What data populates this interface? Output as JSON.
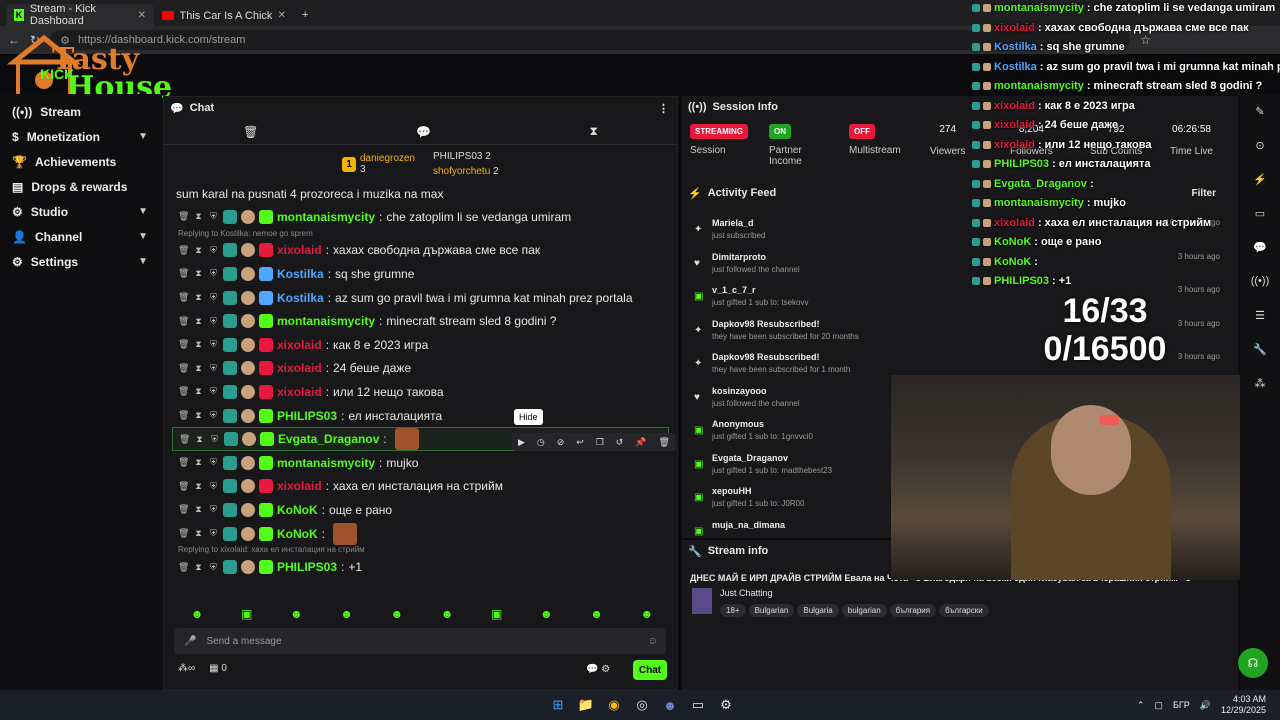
{
  "browser": {
    "tabs": [
      {
        "title": "Stream - Kick Dashboard"
      },
      {
        "title": "This Car Is A Chick Magnet😂"
      }
    ],
    "url": "https://dashboard.kick.com/stream"
  },
  "logo": {
    "line1": "Tasty",
    "line2": "House",
    "kick": "KICK"
  },
  "sidebar": {
    "items": [
      {
        "label": "Stream",
        "icon": "radio-icon"
      },
      {
        "label": "Monetization",
        "icon": "dollar-icon"
      },
      {
        "label": "Achievements",
        "icon": "trophy-icon"
      },
      {
        "label": "Drops & rewards",
        "icon": "drops-icon"
      },
      {
        "label": "Studio",
        "icon": "gear-icon"
      },
      {
        "label": "Channel",
        "icon": "user-icon"
      },
      {
        "label": "Settings",
        "icon": "settings-icon"
      }
    ]
  },
  "chat": {
    "title": "Chat",
    "gifters": [
      {
        "rank": "1",
        "name": "daniegrozen",
        "count": "3"
      },
      {
        "name": "PHILIPS03",
        "count": "2"
      },
      {
        "name": "shofyorchetu",
        "count": "2"
      }
    ],
    "partial": "sum karal na pusnati 4 prozoreca i muzika na max",
    "messages": [
      {
        "user": "montanaismycity",
        "text": "che zatoplim li se vedanga umiram",
        "color": "#53fc18"
      },
      {
        "reply": "Replying to Kostilka: nemoe go sprem",
        "user": "xixolaid",
        "text": "хахах свободна държава сме все пак",
        "color": "#e8193c"
      },
      {
        "user": "Kostilka",
        "text": "sq she grumne",
        "color": "#4ea6ff"
      },
      {
        "user": "Kostilka",
        "text": "az sum go pravil twa i mi grumna kat minah prez portala",
        "color": "#4ea6ff"
      },
      {
        "user": "montanaismycity",
        "text": "minecraft stream sled 8 godini ?",
        "color": "#53fc18"
      },
      {
        "user": "xixolaid",
        "text": "как 8 е 2023 игра",
        "color": "#e8193c"
      },
      {
        "user": "xixolaid",
        "text": "24 беше даже",
        "color": "#e8193c"
      },
      {
        "user": "xixolaid",
        "text": "или 12 нещо такова",
        "color": "#e8193c"
      },
      {
        "user": "PHILIPS03",
        "text": "ел инсталацията",
        "color": "#53fc18"
      },
      {
        "user": "Evgata_Draganov",
        "text": "",
        "color": "#53fc18"
      },
      {
        "user": "montanaismycity",
        "text": "mujko",
        "color": "#53fc18"
      },
      {
        "user": "xixolaid",
        "text": "хаха ел инсталация на стрийм",
        "color": "#e8193c"
      },
      {
        "user": "KoNoK",
        "text": "още е рано",
        "color": "#53fc18"
      },
      {
        "user": "KoNoK",
        "text": "",
        "color": "#53fc18"
      },
      {
        "reply": "Replying to xixolaid: хаха ел инсталация на стрийм",
        "user": "PHILIPS03",
        "text": "+1",
        "color": "#53fc18"
      }
    ],
    "tooltip": "Hide",
    "input_placeholder": "Send a message",
    "send": "Chat",
    "viewer_count": "0"
  },
  "session": {
    "title": "Session Info",
    "stats": [
      {
        "pill": "STREAMING",
        "pill_color": "#e8193c",
        "label": "Session"
      },
      {
        "pill": "ON",
        "pill_color": "#1fa51f",
        "label": "Partner Income"
      },
      {
        "pill": "OFF",
        "pill_color": "#e8193c",
        "label": "Multistream"
      },
      {
        "value": "274",
        "label": "Viewers"
      },
      {
        "value": "8,204",
        "label": "Followers"
      },
      {
        "value": "792",
        "label": "Sub Counts"
      },
      {
        "value": "06:26:58",
        "label": "Time Live"
      }
    ]
  },
  "activity": {
    "title": "Activity Feed",
    "filter": "Filter",
    "items": [
      {
        "name": "Mariela_d",
        "desc": "just subscribed",
        "time": "10 minutes ago"
      },
      {
        "name": "Dimitarproto",
        "desc": "just followed the channel",
        "time": "3 hours ago"
      },
      {
        "name": "v_1_c_7_r",
        "desc": "just gifted 1 sub to: tsekovv",
        "time": "3 hours ago"
      },
      {
        "name": "Dapkov98 Resubscribed!",
        "desc": "they have been subscribed for 20 months",
        "time": "3 hours ago"
      },
      {
        "name": "Dapkov98 Resubscribed!",
        "desc": "they have been subscribed for 1 month",
        "time": "3 hours ago"
      },
      {
        "name": "kosinzayooo",
        "desc": "just followed the channel",
        "time": ""
      },
      {
        "name": "Anonymous",
        "desc": "just gifted 1 sub to: 1gnvvci0",
        "time": ""
      },
      {
        "name": "Evgata_Draganov",
        "desc": "just gifted 1 sub to: madthebest23",
        "time": ""
      },
      {
        "name": "xepouHH",
        "desc": "just gifted 1 sub to: J0R00",
        "time": ""
      },
      {
        "name": "muja_na_dimana",
        "desc": "",
        "time": ""
      }
    ]
  },
  "streaminfo": {
    "title": "Stream info",
    "stream_title": "ДНЕС МАЙ Е ИРЛ ДРАЙВ СТРИЙМ Евала на Чота <3 Благодаря на всеки един гласувал за вчерашния стрийм <3",
    "category": "Just Chatting",
    "tags": [
      "18+",
      "Bulgarian",
      "Bulgaria",
      "bulgarian",
      "българия",
      "български"
    ]
  },
  "overlay": {
    "lines": [
      {
        "user": "montanaismycity",
        "text": "che zatoplim li se vedanga umiram",
        "color": "#53fc18"
      },
      {
        "user": "xixolaid",
        "text": "хахах свободна държава сме все пак",
        "color": "#e8193c"
      },
      {
        "user": "Kostilka",
        "text": "sq she grumne",
        "color": "#4ea6ff"
      },
      {
        "user": "Kostilka",
        "text": "az sum go pravil twa i mi grumna kat minah prez portala",
        "color": "#4ea6ff"
      },
      {
        "user": "montanaismycity",
        "text": "minecraft stream sled 8 godini ?",
        "color": "#53fc18"
      },
      {
        "user": "xixolaid",
        "text": "как 8 е 2023 игра",
        "color": "#e8193c"
      },
      {
        "user": "xixolaid",
        "text": "24 беше даже",
        "color": "#e8193c"
      },
      {
        "user": "xixolaid",
        "text": "или 12 нещо такова",
        "color": "#e8193c"
      },
      {
        "user": "PHILIPS03",
        "text": "ел инсталацията",
        "color": "#53fc18"
      },
      {
        "user": "Evgata_Draganov",
        "text": "",
        "color": "#53fc18"
      },
      {
        "user": "montanaismycity",
        "text": "mujko",
        "color": "#53fc18"
      },
      {
        "user": "xixolaid",
        "text": "хаха ел инсталация на стрийм",
        "color": "#e8193c"
      },
      {
        "user": "KoNoK",
        "text": "още е рано",
        "color": "#53fc18"
      },
      {
        "user": "KoNoK",
        "text": "",
        "color": "#53fc18"
      },
      {
        "user": "PHILIPS03",
        "text": "+1",
        "color": "#53fc18"
      }
    ],
    "counter1": "16/33",
    "counter2": "0/16500"
  },
  "taskbar": {
    "lang": "БГР",
    "time": "4:03 AM",
    "date": "12/29/2025"
  }
}
